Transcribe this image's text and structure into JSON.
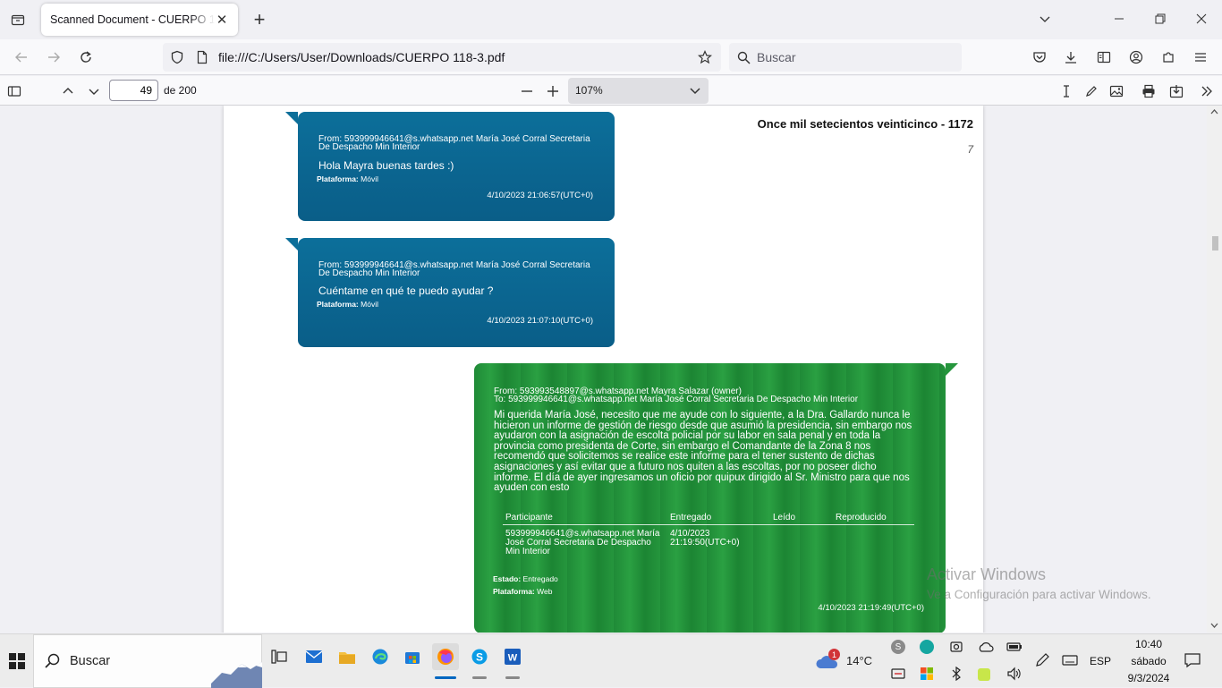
{
  "browser": {
    "tab_title": "Scanned Document - CUERPO 118-3.pdf",
    "url": "file:///C:/Users/User/Downloads/CUERPO 118-3.pdf",
    "search_placeholder": "Buscar"
  },
  "pdf_toolbar": {
    "page_number": "49",
    "page_of": "de 200",
    "zoom": "107%"
  },
  "document": {
    "heading": "Once mil setecientos veinticinco - 1172",
    "corner_mark": "7",
    "messages": [
      {
        "from_line1": "From: 593999946641@s.whatsapp.net María José  Corral Secretaria",
        "from_line2": "De Despacho Min Interior",
        "text": "Hola Mayra buenas tardes :)",
        "platform_label": "Plataforma:",
        "platform": "Móvil",
        "timestamp": "4/10/2023 21:06:57(UTC+0)"
      },
      {
        "from_line1": "From: 593999946641@s.whatsapp.net María José  Corral Secretaria",
        "from_line2": "De Despacho Min Interior",
        "text": "Cuéntame en qué te puedo ayudar ?",
        "platform_label": "Plataforma:",
        "platform": "Móvil",
        "timestamp": "4/10/2023 21:07:10(UTC+0)"
      }
    ],
    "outgoing": {
      "from": "From: 593993548897@s.whatsapp.net Mayra Salazar (owner)",
      "to": "To: 593999946641@s.whatsapp.net María José  Corral Secretaria De Despacho Min Interior",
      "body_lines": [
        "Mi querida María José, necesito que me ayude con lo siguiente,  a la Dra. Gallardo nunca le",
        "hicieron un informe de gestión de riesgo desde que asumió la presidencia, sin embargo nos",
        "ayudaron con la asignación de escolta policial por su labor en sala penal y en toda la",
        "provincia como presidenta de Corte, sin embargo el Comandante de la Zona 8 nos",
        "recomendó que solicitemos se realice este informe para el tener sustento de dichas",
        "asignaciones y así evitar que a futuro nos quiten a las escoltas, por no poseer dicho",
        "informe. El día de ayer ingresamos un oficio por quipux dirigido al Sr. Ministro para que nos",
        "ayuden con esto"
      ],
      "table_headers": [
        "Participante",
        "Entregado",
        "Leído",
        "Reproducido"
      ],
      "participant_lines": [
        "593999946641@s.whatsapp.net María",
        "José  Corral Secretaria De Despacho",
        "Min Interior"
      ],
      "delivered_lines": [
        "4/10/2023",
        "21:19:50(UTC+0)"
      ],
      "status_label": "Estado:",
      "status": "Entregado",
      "platform_label": "Plataforma:",
      "platform": "Web",
      "timestamp": "4/10/2023 21:19:49(UTC+0)"
    }
  },
  "watermark": {
    "title": "Activar Windows",
    "subtitle": "Ve a Configuración para activar Windows."
  },
  "taskbar": {
    "search_label": "Buscar",
    "weather_temp": "14°C",
    "weather_badge": "1",
    "language": "ESP",
    "time": "10:40",
    "day": "sábado",
    "date": "9/3/2024"
  },
  "colors": {
    "incoming_bubble": "#0b6590",
    "outgoing_bubble": "#25963d",
    "firefox_bg": "#f0f0f4"
  }
}
